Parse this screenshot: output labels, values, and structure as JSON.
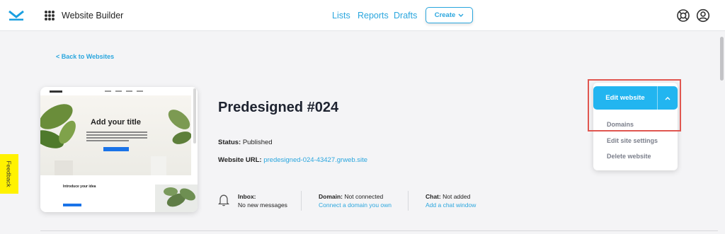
{
  "header": {
    "app_title": "Website Builder",
    "nav": [
      "Lists",
      "Reports",
      "Drafts"
    ],
    "create_label": "Create",
    "icons": [
      "envelope-logo-icon",
      "apps-grid-icon",
      "help-lifebuoy-icon",
      "profile-icon"
    ]
  },
  "page": {
    "back_label": "< Back to Websites",
    "site_title": "Predesigned #024",
    "status_label": "Status:",
    "status_value": "Published",
    "url_label": "Website URL:",
    "url_value": "predesigned-024-43427.grweb.site"
  },
  "thumbnail": {
    "logo_text": "LOGO",
    "hero_title": "Add your title",
    "intro_title": "Introduce your idea"
  },
  "info": {
    "inbox_label": "Inbox:",
    "inbox_value": "No new messages",
    "domain_label": "Domain:",
    "domain_value": "Not connected",
    "domain_link": "Connect a domain you own",
    "chat_label": "Chat:",
    "chat_value": "Not added",
    "chat_link": "Add a chat window"
  },
  "actions": {
    "edit_label": "Edit website",
    "menu": [
      "Domains",
      "Edit site settings",
      "Delete website"
    ]
  },
  "feedback_label": "Feedback",
  "colors": {
    "accent": "#2aa6de",
    "primary_button": "#22b5f0",
    "highlight": "#e05650",
    "feedback": "#fff200"
  }
}
